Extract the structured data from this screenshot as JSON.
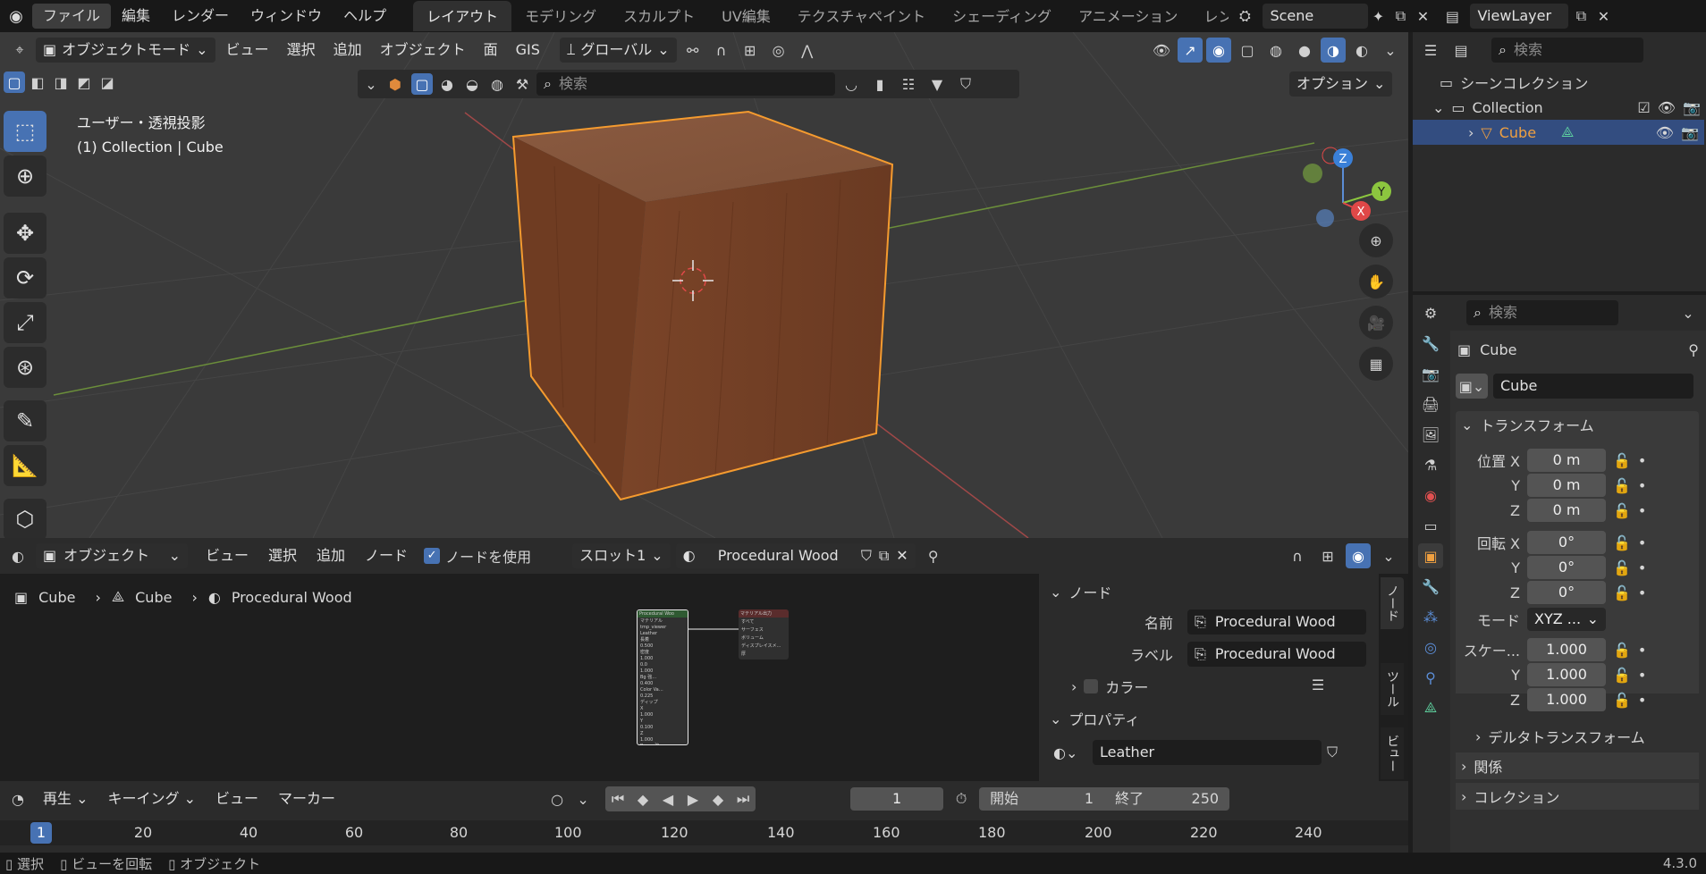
{
  "topbar": {
    "menus": [
      "ファイル",
      "編集",
      "レンダー",
      "ウィンドウ",
      "ヘルプ"
    ],
    "workspaces": [
      "レイアウト",
      "モデリング",
      "スカルプト",
      "UV編集",
      "テクスチャペイント",
      "シェーディング",
      "アニメーション",
      "レン"
    ],
    "scene": "Scene",
    "viewlayer": "ViewLayer"
  },
  "viewport": {
    "mode": "オブジェクトモード",
    "menus": [
      "ビュー",
      "選択",
      "追加",
      "オブジェクト",
      "面",
      "GIS"
    ],
    "transform": "グローバル",
    "search_placeholder": "検索",
    "options": "オプション",
    "overlay_line1": "ユーザー・透視投影",
    "overlay_line2": "(1) Collection | Cube",
    "gizmo": {
      "z": "Z",
      "y": "Y",
      "x": "X"
    }
  },
  "node_editor": {
    "type": "オブジェクト",
    "menus": [
      "ビュー",
      "選択",
      "追加",
      "ノード"
    ],
    "use_nodes": "ノードを使用",
    "slot": "スロット1",
    "material": "Procedural Wood",
    "breadcrumb": [
      "Cube",
      "Cube",
      "Procedural Wood"
    ],
    "node_left_title": "Procedural Woo",
    "node_left_lines": [
      "マテリアル",
      "tmp_viewer",
      "Leather",
      "長着",
      "0.500",
      "密度",
      "1.000",
      "0.0",
      "1.000",
      "Bg 強…",
      "0.400",
      "Color Va…",
      "0.225",
      "ディップ",
      "X",
      "1.000",
      "Y",
      "0.100",
      "Z",
      "1.000",
      "Bump 強…",
      "0.025",
      "粗さ",
      "0.000",
      "コント…",
      "0.000",
      "オフセ…",
      "0.000"
    ],
    "node_right_title": "マテリアル出力",
    "node_right_lines": [
      "すべて",
      "サーフェス",
      "ボリューム",
      "ディスプレイスメ…",
      "厚"
    ],
    "sidebar": {
      "node_panel": "ノード",
      "name_label": "名前",
      "name_value": "Procedural Wood",
      "label_label": "ラベル",
      "label_value": "Procedural Wood",
      "color_label": "カラー",
      "properties_panel": "プロパティ",
      "group_value": "Leather",
      "tabs": [
        "ノード",
        "ツール",
        "ビュー"
      ]
    }
  },
  "timeline": {
    "menus": [
      "再生",
      "キーイング",
      "ビュー",
      "マーカー"
    ],
    "current_frame": "1",
    "start_label": "開始",
    "start": "1",
    "end_label": "終了",
    "end": "250",
    "ruler": [
      "1",
      "20",
      "40",
      "60",
      "80",
      "100",
      "120",
      "140",
      "160",
      "180",
      "200",
      "220",
      "240"
    ]
  },
  "status": {
    "items": [
      "選択",
      "ビューを回転",
      "オブジェクト"
    ],
    "version": "4.3.0"
  },
  "outliner": {
    "search_placeholder": "検索",
    "scene_collection": "シーンコレクション",
    "collection": "Collection",
    "object": "Cube"
  },
  "properties": {
    "search_placeholder": "検索",
    "object_name_header": "Cube",
    "object_name_field": "Cube",
    "transform_panel": "トランスフォーム",
    "location_label": "位置 X",
    "loc_x": "0 m",
    "loc_y": "0 m",
    "loc_z": "0 m",
    "rotation_label": "回転 X",
    "rot_x": "0°",
    "rot_y": "0°",
    "rot_z": "0°",
    "mode_label": "モード",
    "mode_value": "XYZ ...",
    "scale_label": "スケー...",
    "scale_x": "1.000",
    "scale_y": "1.000",
    "scale_z": "1.000",
    "y_label": "Y",
    "z_label": "Z",
    "delta_panel": "デルタトランスフォーム",
    "relations_panel": "関係",
    "collection_panel": "コレクション"
  }
}
